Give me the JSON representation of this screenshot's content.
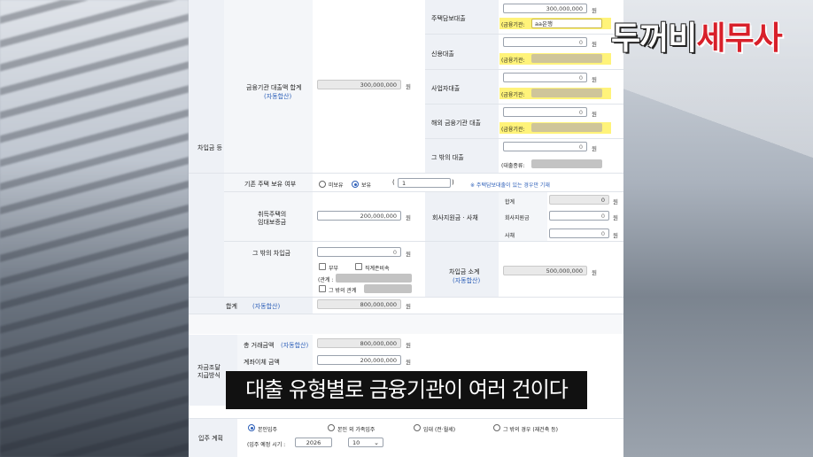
{
  "logo": {
    "part1": "두꺼비",
    "part2": "세무사"
  },
  "caption": "대출 유형별로 금융기관이 여러 건이다",
  "section_borrow": {
    "title": "차입금 등",
    "total_label": "금융기관 대출액 합계",
    "auto_calc": "(자동합산)",
    "total_value": "300,000,000",
    "unit": "원",
    "loans": [
      {
        "label": "주택담보대출",
        "amount": "300,000,000",
        "inst_label": "(금융기관:",
        "inst_value": "aa은행"
      },
      {
        "label": "신용대출",
        "amount": "0",
        "inst_label": "(금융기관:",
        "inst_value": ""
      },
      {
        "label": "사업자대출",
        "amount": "0",
        "inst_label": "(금융기관:",
        "inst_value": ""
      },
      {
        "label": "해외 금융기관 대출",
        "amount": "0",
        "inst_label": "(금융기관:",
        "inst_value": ""
      },
      {
        "label": "그 밖의 대출",
        "amount": "0",
        "inst_label": "(대출종류:",
        "inst_value": ""
      }
    ],
    "existing_home_label": "기존 주택 보유 여부",
    "opt_none": "미보유",
    "opt_have": "보유",
    "count_open": "(",
    "count_value": "1",
    "count_close": ")",
    "existing_note": "※ 주택담보대출이 있는 경우만 기재",
    "deposit_label_1": "취득주택의",
    "deposit_label_2": "임대보증금",
    "deposit_value": "200,000,000",
    "support_label": "회사지원금 · 사채",
    "support_sum_label": "합계",
    "support_sum_value": "0",
    "support_company_label": "회사지원금",
    "support_company_value": "0",
    "support_bond_label": "사채",
    "support_bond_value": "0",
    "other_borrow_label": "그 밖의 차입금",
    "other_borrow_value": "0",
    "rel_spouse": "부부",
    "rel_direct": "직계존비속",
    "rel_open": "(관계 :",
    "rel_other": "그 밖의 관계",
    "borrow_subtotal_label": "차입금 소계",
    "borrow_subtotal_value": "500,000,000",
    "sum_label": "합계",
    "sum_value": "800,000,000"
  },
  "section_plan": {
    "title_1": "자금조달",
    "title_2": "지급방식",
    "total_trade_label": "총 거래금액",
    "total_trade_value": "800,000,000",
    "contract_label": "계좌이체 금액",
    "contract_value": "200,000,000"
  },
  "section_move": {
    "title": "입주 계획",
    "opt_self": "본인입주",
    "opt_family": "본인 외 가족입주",
    "opt_rent": "임대 (전·월세)",
    "opt_other": "그 밖의 경우 (재건축 등)",
    "schedule_label": "(입주 예정 시기 :",
    "year": "2026",
    "month": "10"
  }
}
